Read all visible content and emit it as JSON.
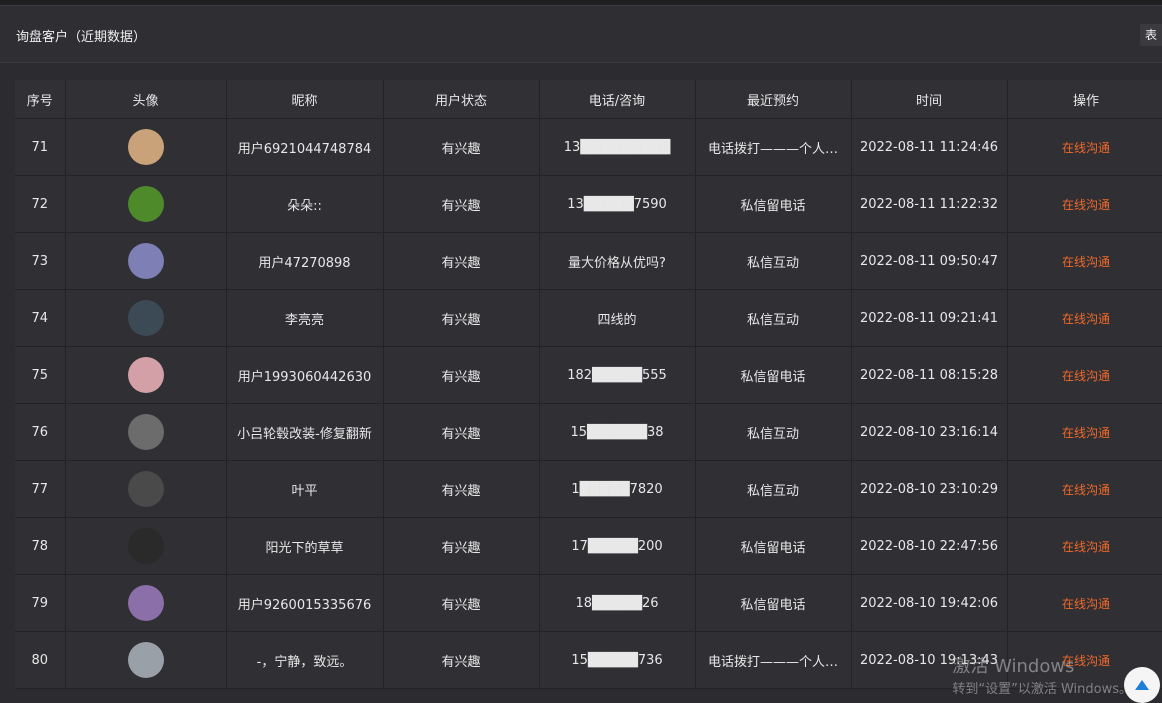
{
  "header": {
    "title": "询盘客户（近期数据）",
    "action_label": "表"
  },
  "table": {
    "columns": [
      "序号",
      "头像",
      "昵称",
      "用户状态",
      "电话/咨询",
      "最近预约",
      "时间",
      "操作"
    ],
    "rows": [
      {
        "no": "71",
        "avatar_color": "#c9a27a",
        "nickname": "用户6921044748784",
        "status": "有兴趣",
        "phone": "13█████████",
        "reserve": "电话拨打———个人…",
        "time": "2022-08-11 11:24:46",
        "action": "在线沟通"
      },
      {
        "no": "72",
        "avatar_color": "#4f8a2a",
        "nickname": "朵朵::",
        "status": "有兴趣",
        "phone": "13█████7590",
        "reserve": "私信留电话",
        "time": "2022-08-11 11:22:32",
        "action": "在线沟通"
      },
      {
        "no": "73",
        "avatar_color": "#7d7fb5",
        "nickname": "用户47270898",
        "status": "有兴趣",
        "phone": "量大价格从优吗?",
        "reserve": "私信互动",
        "time": "2022-08-11 09:50:47",
        "action": "在线沟通"
      },
      {
        "no": "74",
        "avatar_color": "#3b4a55",
        "nickname": "李亮亮",
        "status": "有兴趣",
        "phone": "四线的",
        "reserve": "私信互动",
        "time": "2022-08-11 09:21:41",
        "action": "在线沟通"
      },
      {
        "no": "75",
        "avatar_color": "#d4a0a8",
        "nickname": "用户1993060442630",
        "status": "有兴趣",
        "phone": "182█████555",
        "reserve": "私信留电话",
        "time": "2022-08-11 08:15:28",
        "action": "在线沟通"
      },
      {
        "no": "76",
        "avatar_color": "#6c6c6c",
        "nickname": "小吕轮毂改装-修复翻新",
        "status": "有兴趣",
        "phone": "15██████38",
        "reserve": "私信互动",
        "time": "2022-08-10 23:16:14",
        "action": "在线沟通"
      },
      {
        "no": "77",
        "avatar_color": "#4a4a4a",
        "nickname": "叶平",
        "status": "有兴趣",
        "phone": "1█████7820",
        "reserve": "私信互动",
        "time": "2022-08-10 23:10:29",
        "action": "在线沟通"
      },
      {
        "no": "78",
        "avatar_color": "#2a2a2a",
        "nickname": "阳光下的草草",
        "status": "有兴趣",
        "phone": "17█████200",
        "reserve": "私信留电话",
        "time": "2022-08-10 22:47:56",
        "action": "在线沟通"
      },
      {
        "no": "79",
        "avatar_color": "#8a6fa8",
        "nickname": "用户9260015335676",
        "status": "有兴趣",
        "phone": "18█████26",
        "reserve": "私信留电话",
        "time": "2022-08-10 19:42:06",
        "action": "在线沟通"
      },
      {
        "no": "80",
        "avatar_color": "#9aa0a8",
        "nickname": "-，宁静，致远。",
        "status": "有兴趣",
        "phone": "15█████736",
        "reserve": "电话拨打———个人…",
        "time": "2022-08-10 19:13:43",
        "action": "在线沟通"
      }
    ]
  },
  "watermark": {
    "line1": "激活 Windows",
    "line2": "转到“设置”以激活 Windows。"
  },
  "icons": {
    "scroll_top": "arrow-up-icon"
  }
}
